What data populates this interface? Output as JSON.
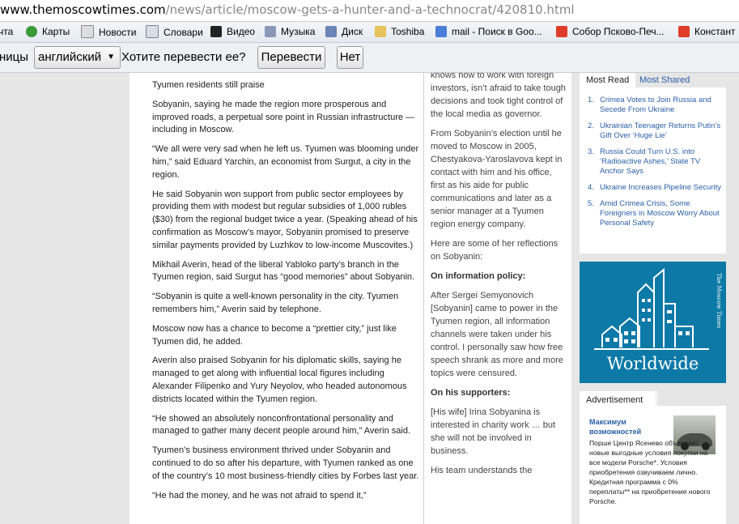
{
  "browser": {
    "url_domain": "www.themoscowtimes.com",
    "url_path": "/news/article/moscow-gets-a-hunter-and-a-technocrat/420810.html",
    "bookmarks": [
      {
        "label": "чта",
        "icon": "mail-icon"
      },
      {
        "label": "Карты",
        "icon": "maps-icon"
      },
      {
        "label": "Новости",
        "icon": "news-icon"
      },
      {
        "label": "Словари",
        "icon": "dictionary-icon"
      },
      {
        "label": "Видео",
        "icon": "video-icon"
      },
      {
        "label": "Музыка",
        "icon": "music-icon"
      },
      {
        "label": "Диск",
        "icon": "disk-icon"
      },
      {
        "label": "Toshiba",
        "icon": "folder-icon"
      },
      {
        "label": "mail - Поиск в Goo...",
        "icon": "google-icon"
      },
      {
        "label": "Собор Псково-Печ...",
        "icon": "yandex-icon"
      },
      {
        "label": "Констант",
        "icon": "yandex-icon"
      }
    ]
  },
  "translate_bar": {
    "prefix": "ницы",
    "language": "английский",
    "question": "Хотите перевести ее?",
    "translate_button": "Перевести",
    "no_button": "Нет"
  },
  "article": {
    "paragraphs": [
      "Tyumen residents still praise",
      "Sobyanin, saying he made the region more prosperous and improved roads, a perpetual sore point in Russian infrastructure — including in Moscow.",
      "“We all were very sad when he left us. Tyumen was blooming under him,” said Eduard Yarchin, an economist from Surgut, a city in the region.",
      "He said Sobyanin won support from public sector employees by providing them with modest but regular subsidies of 1,000 rubles ($30) from the regional budget twice a year. (Speaking ahead of his confirmation as Moscow’s mayor, Sobyanin promised to preserve similar payments provided by Luzhkov to low-income Muscovites.)",
      "Mikhail Averin, head of the liberal Yabloko party’s branch in the Tyumen region, said Surgut has “good memories” about Sobyanin.",
      "“Sobyanin is quite a well-known personality in the city. Tyumen remembers him,” Averin said by telephone.",
      "Moscow now has a chance to become a “prettier city,” just like Tyumen did, he added.",
      "Averin also praised Sobyanin for his diplomatic skills, saying he managed to get along with influential local figures including Alexander Filipenko and Yury Neyolov, who headed autonomous districts located within the Tyumen region.",
      "“He showed an absolutely nonconfrontational personality and managed to gather many decent people around him,” Averin said.",
      "Tyumen’s business environment thrived under Sobyanin and continued to do so after his departure, with Tyumen ranked as one of the country’s 10 most business-friendly cities by Forbes last year.",
      "“He had the money, and he was not afraid to spend it,”"
    ]
  },
  "sidebar_quote": {
    "p1": "knows how to work with foreign investors, isn’t afraid to take tough decisions and took tight control of the local media as governor.",
    "p2": "From Sobyanin’s election until he moved to Moscow in 2005, Chestyakova-Yaroslavova kept in contact with him and his office, first as his aide for public communications and later as a senior manager at a Tyumen region energy company.",
    "p3": "Here are some of her reflections on Sobyanin:",
    "h1": "On information policy:",
    "p4": "After Sergei Semyonovich [Sobyanin] came to power in the Tyumen region, all information channels were taken under his control. I personally saw how free speech shrank as more and more topics were censured.",
    "h2": "On his supporters:",
    "p5": "[His wife] Irina Sobyanina is interested in charity work … but she will not be involved in business.",
    "p6": "His team understands the"
  },
  "most_read": {
    "tab_active": "Most Read",
    "tab_inactive": "Most Shared",
    "items": [
      {
        "n": "1.",
        "text": "Crimea Votes to Join Russia and Secede From Ukraine"
      },
      {
        "n": "2.",
        "text": "Ukrainian Teenager Returns Putin’s Gift Over ‘Huge Lie’"
      },
      {
        "n": "3.",
        "text": "Russia Could Turn U.S. into ‘Radioactive Ashes,’ State TV Anchor Says"
      },
      {
        "n": "4.",
        "text": "Ukraine Increases Pipeline Security"
      },
      {
        "n": "5.",
        "text": "Amid Crimea Crisis, Some Foreigners in Moscow Worry About Personal Safety"
      }
    ]
  },
  "banner": {
    "title": "Worldwide",
    "side_text": "The Moscow Times",
    "color": "#0d79a7"
  },
  "ad": {
    "header": "Advertisement",
    "title": "Максимум возможностей",
    "text_line1": "Порше Центр Ясенево объявляет новые выгодные условия покупки на все модели Porsche*. Условия приобретения озвучиваем лично. Кредитная программа с 0% переплаты** на приобретение нового Porsche."
  }
}
